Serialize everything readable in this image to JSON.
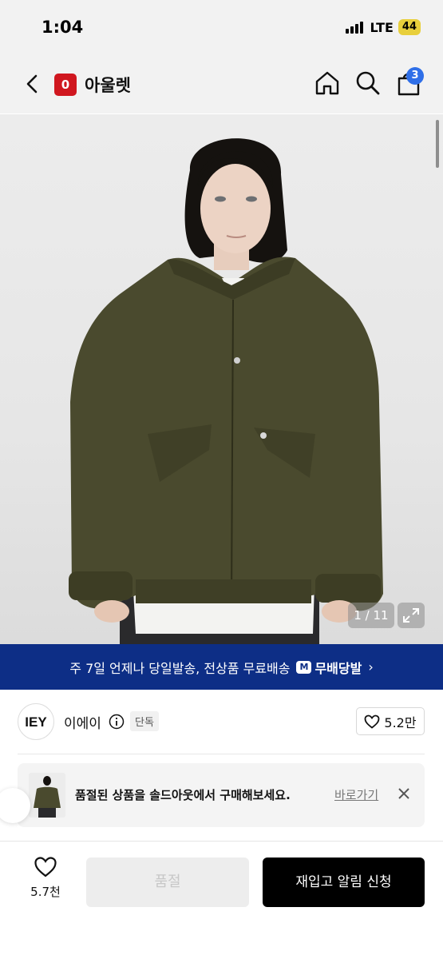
{
  "status_bar": {
    "time": "1:04",
    "network": "LTE",
    "battery": "44"
  },
  "nav": {
    "title": "아울렛",
    "brand_logo_text": "0",
    "cart_count": "3"
  },
  "gallery": {
    "counter": "1 / 11"
  },
  "shipping_banner": {
    "text": "주 7일 언제나 당일발송, 전상품 무료배송",
    "badge_mark": "M",
    "badge_label": "무배당발",
    "chevron": "›"
  },
  "brand": {
    "logo_text": "IEY",
    "name": "이에이",
    "badge": "단독",
    "likes": "5.2만"
  },
  "notice": {
    "text": "품절된 상품을 솔드아웃에서 구매해보세요.",
    "link": "바로가기"
  },
  "bottom_bar": {
    "wish_count": "5.7천",
    "soldout_label": "품절",
    "restock_label": "재입고 알림 신청"
  },
  "colors": {
    "banner": "#0d2e86",
    "brand_red": "#d0171f",
    "badge_blue": "#2f6fe8",
    "jacket": "#4a4a2e"
  }
}
